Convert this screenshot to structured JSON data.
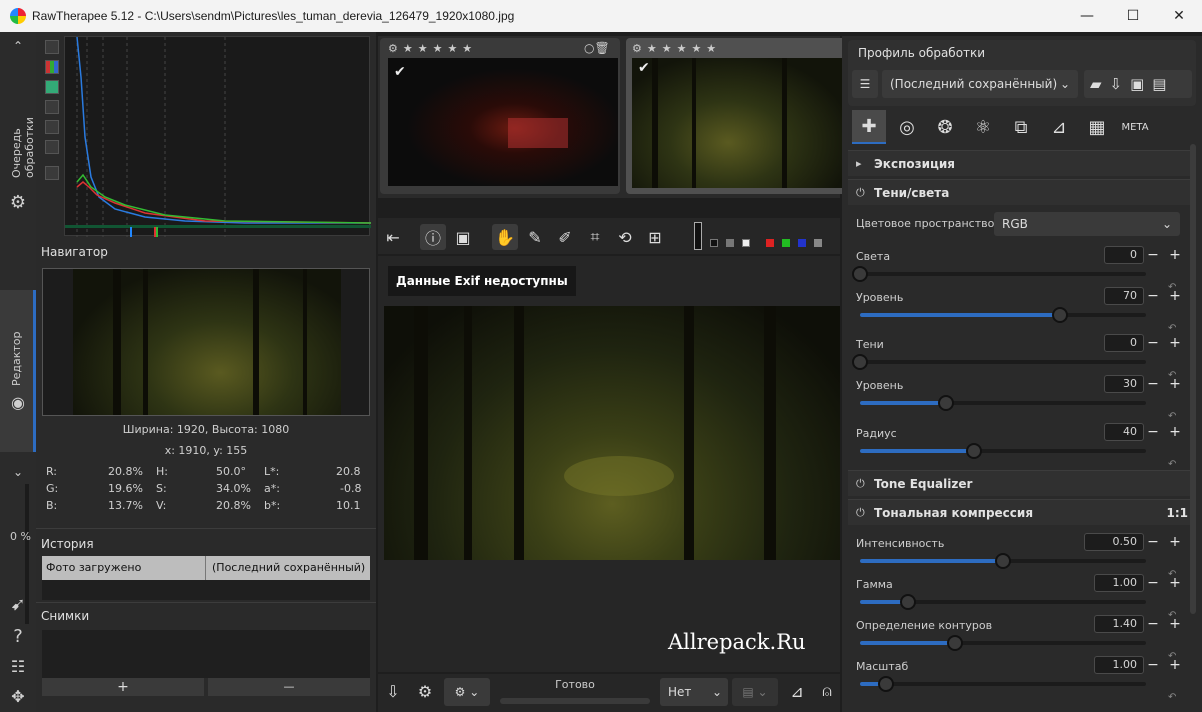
{
  "window": {
    "title": "RawTherapee 5.12 - C:\\Users\\sendm\\Pictures\\les_tuman_derevia_126479_1920x1080.jpg",
    "minimize": "—",
    "maximize": "☐",
    "close": "✕"
  },
  "vtabs": {
    "queue": "Очередь обработки",
    "editor": "Редактор",
    "zoom_label": "0 %"
  },
  "navigator": {
    "title": "Навигатор",
    "size_text": "Ширина: 1920, Высота: 1080",
    "coords": "x: 1910, y: 155"
  },
  "readout": {
    "r_label": "R:",
    "r": "20.8%",
    "g_label": "G:",
    "g": "19.6%",
    "b_label": "B:",
    "b": "13.7%",
    "h_label": "H:",
    "h": "50.0°",
    "s_label": "S:",
    "s": "34.0%",
    "v_label": "V:",
    "v": "20.8%",
    "l_label": "L*:",
    "l": "20.8",
    "a_label": "a*:",
    "a": "-0.8",
    "bb_label": "b*:",
    "bb": "10.1"
  },
  "history": {
    "title": "История",
    "row_label": "Фото загружено",
    "row_value": "(Последний сохранённый)"
  },
  "snapshots": {
    "title": "Снимки",
    "add": "+",
    "remove": "—"
  },
  "preview": {
    "exif_msg": "Данные Exif недоступны",
    "watermark": "Allrepack.Ru"
  },
  "bottom": {
    "status": "Готово",
    "select_value": "Нет"
  },
  "profile": {
    "title": "Профиль обработки",
    "value": "(Последний сохранённый)"
  },
  "tools": {
    "exposure": "Экспозиция",
    "shadows": "Тени/света",
    "colorspace_label": "Цветовое пространство:",
    "colorspace_value": "RGB",
    "highlights_label": "Света",
    "highlights_value": "0",
    "level1_label": "Уровень",
    "level1_value": "70",
    "shadows_label": "Тени",
    "shadows_value": "0",
    "level2_label": "Уровень",
    "level2_value": "30",
    "radius_label": "Радиус",
    "radius_value": "40",
    "tone_eq": "Tone Equalizer",
    "tonemap": "Тональная компрессия",
    "tonemap_ratio": "1:1",
    "intensity_label": "Интенсивность",
    "intensity_value": "0.50",
    "gamma_label": "Гамма",
    "gamma_value": "1.00",
    "edge_label": "Определение контуров",
    "edge_value": "1.40",
    "scale_label": "Масштаб",
    "scale_value": "1.00"
  },
  "sliders": {
    "highlights": 0,
    "level1": 70,
    "shadows": 0,
    "level2": 30,
    "radius": 40,
    "intensity": 0.5,
    "gamma": 1.0,
    "edge": 1.4,
    "scale": 1.0
  },
  "colors": {
    "accent": "#2d6cc1",
    "titlebar": "#f3f3f3",
    "panel": "#2a2a2a"
  }
}
